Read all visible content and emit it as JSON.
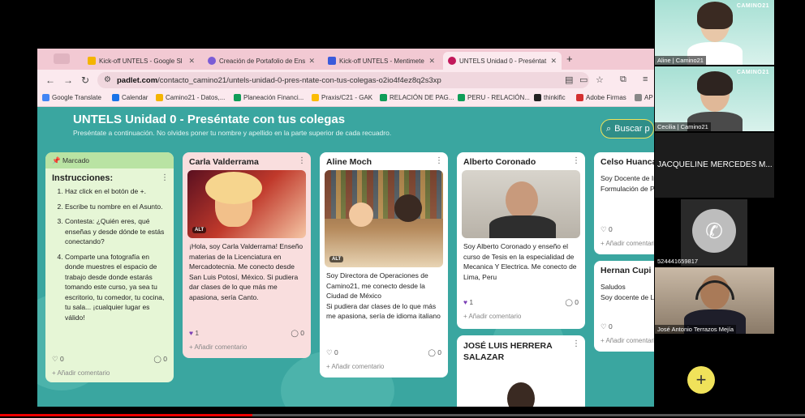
{
  "browser": {
    "tabs": [
      {
        "label": "Kick-off UNTELS - Google Sl",
        "color": "#f4b400"
      },
      {
        "label": "Creación de Portafolio de Ens",
        "color": "#7b5cd6"
      },
      {
        "label": "Kick-off UNTELS - Mentimete",
        "color": "#3b5bdb"
      },
      {
        "label": "UNTELS Unidad 0 - Preséntat",
        "color": "#c2185b"
      }
    ],
    "url_site": "padlet.com",
    "url_path": "/contacto_camino21/untels-unidad-0-pres-ntate-con-tus-colegas-o2io4f4ez8q2s3xp",
    "bookmarks": [
      {
        "label": "Google Translate",
        "color": "#4285f4"
      },
      {
        "label": "Calendar",
        "color": "#1a73e8"
      },
      {
        "label": "Camino21 - Datos,...",
        "color": "#f4b400"
      },
      {
        "label": "Planeación Financi...",
        "color": "#0f9d58"
      },
      {
        "label": "Praxis/C21 - GAK",
        "color": "#fbbc05"
      },
      {
        "label": "RELACIÓN DE PAG...",
        "color": "#0f9d58"
      },
      {
        "label": "PERU - RELACIÓN...",
        "color": "#0f9d58"
      },
      {
        "label": "thinkific",
        "color": "#222222"
      },
      {
        "label": "Adobe Firmas",
        "color": "#d32f2f"
      },
      {
        "label": "AP",
        "color": "#888888"
      }
    ]
  },
  "padlet": {
    "title": "UNTELS Unidad 0 - Preséntate con tus colegas",
    "subtitle": "Preséntate a continuación. No olvides poner tu nombre y apellido en la parte superior de cada recuadro.",
    "search_placeholder": "Buscar p",
    "instructions": {
      "pinned": "Marcado",
      "title": "Instrucciones:",
      "items": [
        "Haz click en el botón de +.",
        "Escribe tu nombre en el Asunto.",
        "Contesta: ¿Quién eres, qué enseñas y desde dónde te estás conectando?",
        "Comparte una fotografía en donde muestres el espacio de trabajo desde donde estarás tomando este curso, ya sea tu escritorio, tu comedor, tu cocina, tu sala... ¡cualquier lugar es válido!"
      ],
      "likes": "0",
      "comments": "0",
      "add_comment": "Añadir comentario"
    },
    "cards": [
      {
        "name": "Carla Valderrama",
        "text": "¡Hola, soy Carla Valderrama! Enseño materias de la Licenciatura en Mercadotecnia. Me conecto desde San Luis Potosí, México. Si pudiera dar clases de lo que más me apasiona, sería Canto.",
        "likes": "1",
        "comments": "0",
        "add_comment": "Añadir comentario",
        "alt": "ALT"
      },
      {
        "name": "Aline Moch",
        "text": "Soy Directora de Operaciones de Camino21, me conecto desde la Ciudad de México\nSi pudiera dar clases de lo que más me apasiona, sería de idioma italiano",
        "likes": "0",
        "comments": "0",
        "add_comment": "Añadir comentario",
        "alt": "ALT"
      },
      {
        "name": "Alberto Coronado",
        "text": "Soy Alberto Coronado y enseño el curso de Tesis en la especialidad de Mecanica Y Electrica. Me conecto de Lima, Peru",
        "likes": "1",
        "comments": "0",
        "add_comment": "Añadir comentario"
      },
      {
        "name": "JOSÉ LUIS HERRERA SALAZAR"
      },
      {
        "name": "Celso Huanca",
        "text": "Soy Docente de Ingeniería de Sis Formulación de P Saludos desde P",
        "likes": "0",
        "add_comment": "Añadir comentari"
      },
      {
        "name": "Hernan Cupi",
        "text": "Saludos\nSoy docente de Lima - Perú",
        "likes": "0",
        "add_comment": "Añadir comentario"
      }
    ]
  },
  "participants": [
    {
      "name": "Aline | Camino21",
      "brand": "CAMINO21"
    },
    {
      "name": "Cecilia | Camino21",
      "brand": "CAMINO21"
    },
    {
      "name": "JACQUELINE MERCEDES M..."
    },
    {
      "name": "524441659817"
    },
    {
      "name": "José Antonio Terrazos Mejía"
    }
  ]
}
